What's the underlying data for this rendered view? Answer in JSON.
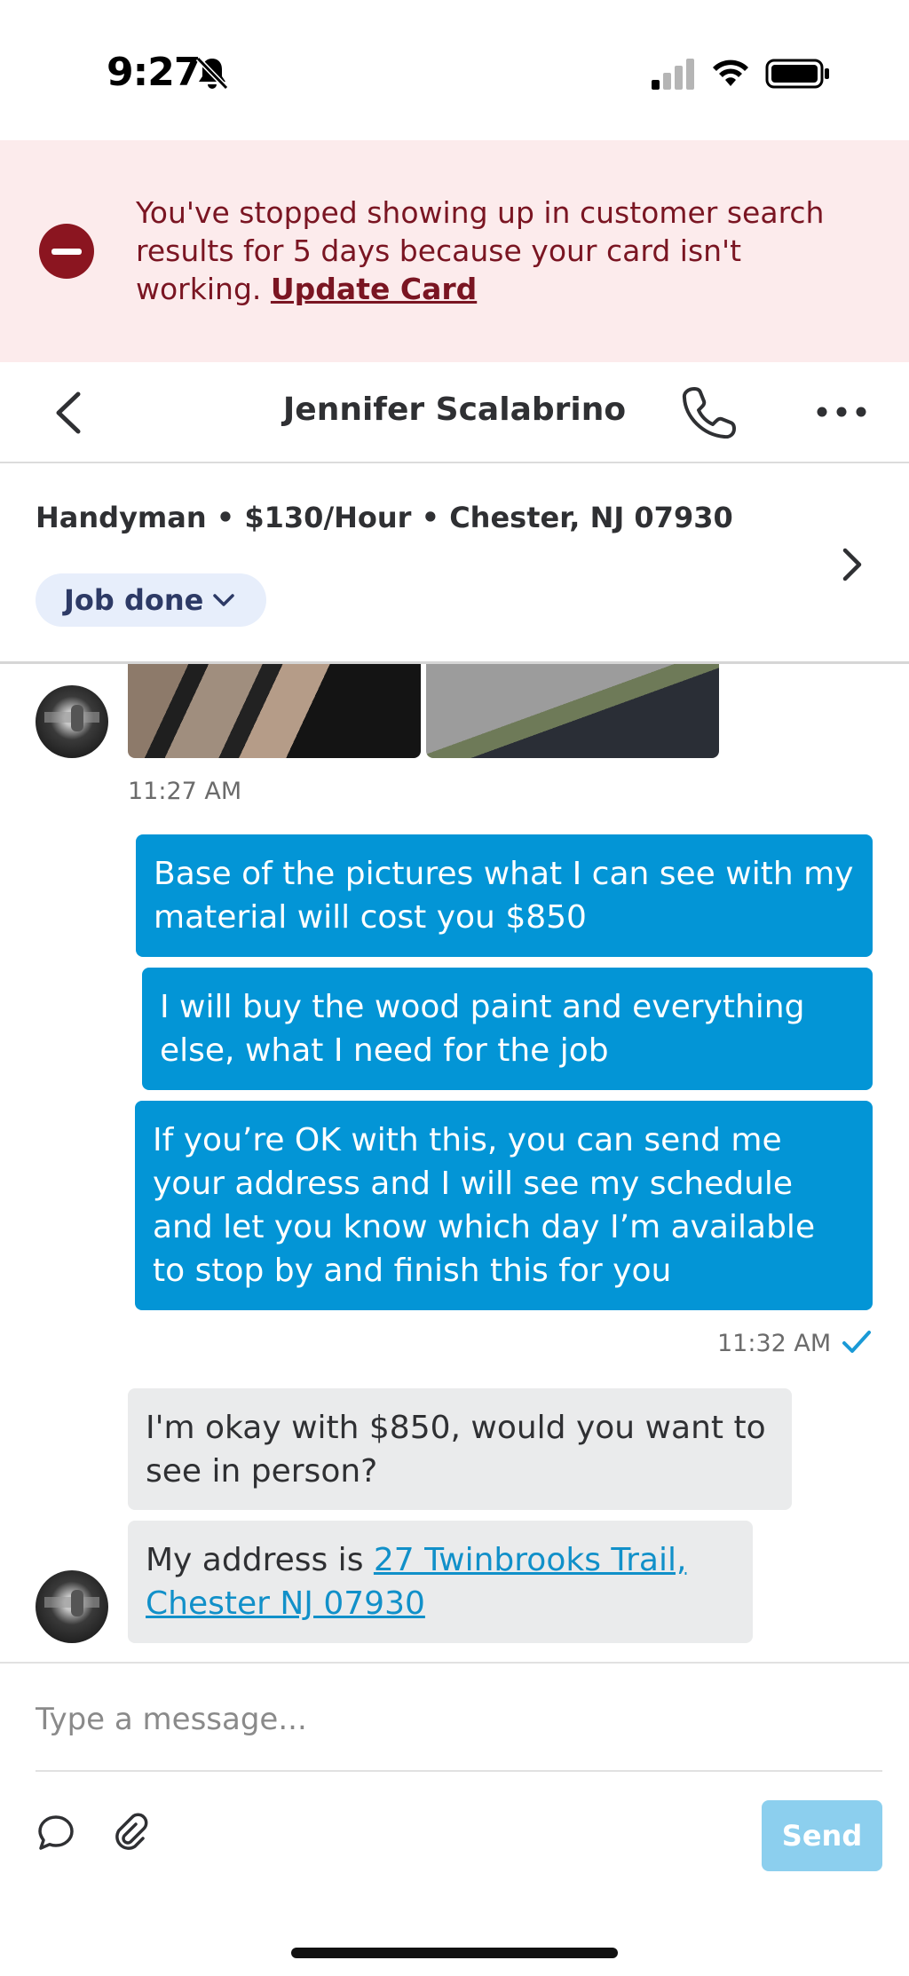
{
  "status_bar": {
    "time": "9:27",
    "icons": [
      "bell-off-icon",
      "cellular-signal-icon",
      "wifi-icon",
      "battery-icon"
    ]
  },
  "banner": {
    "message": "You've stopped showing up in customer search results for 5 days because your card isn't working.",
    "link_label": "Update Card",
    "icon": "minus-circle-icon",
    "colors": {
      "background": "#fcebec",
      "text": "#7a1522",
      "icon": "#8b1520"
    }
  },
  "header": {
    "contact_name": "Jennifer Scalabrino",
    "icons": [
      "chevron-left-icon",
      "phone-icon",
      "more-dots-icon"
    ]
  },
  "job": {
    "details": "Handyman • $130/Hour • Chester, NJ 07930",
    "status_label": "Job done"
  },
  "conversation": {
    "photos_timestamp": "11:27 AM",
    "outgoing": [
      "Base of the pictures what I can see with my material will cost you $850",
      "I will buy the wood paint and everything else, what I need for the job",
      "If you’re OK with this, you can send me your address and I will see my schedule and let you know which day I’m available to stop by and finish this for you"
    ],
    "outgoing_timestamp": "11:32 AM",
    "incoming_1": "I'm okay with $850, would you want to see in person?",
    "incoming_2_prefix": "My address is ",
    "incoming_2_link": "27 Twinbrooks Trail, Chester NJ 07930",
    "colors": {
      "outgoing_bubble": "#0395d6",
      "incoming_bubble": "#eaebec",
      "read_check": "#1a9ad6"
    }
  },
  "composer": {
    "placeholder": "Type a message...",
    "send_label": "Send",
    "icons": [
      "quick-reply-icon",
      "attachment-icon"
    ],
    "send_color": "#8ccfee"
  }
}
